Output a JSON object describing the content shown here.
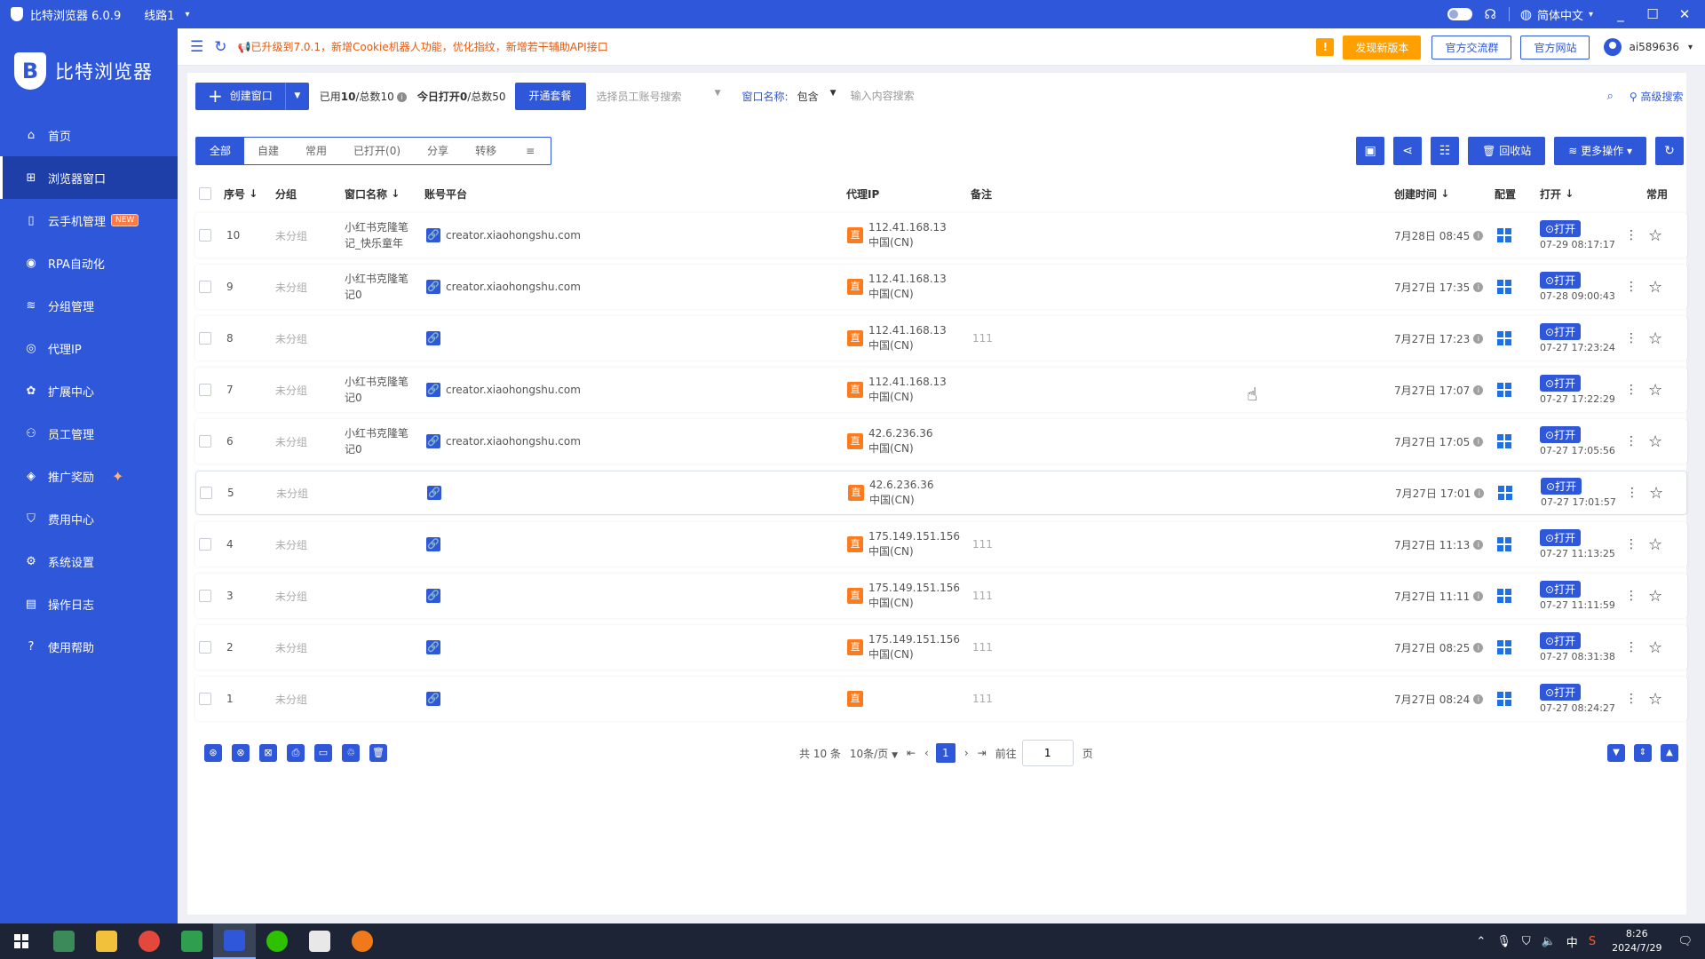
{
  "app": {
    "title": "比特浏览器 6.0.9",
    "line": "线路1",
    "language": "简体中文"
  },
  "sidebar": {
    "brand": "比特浏览器",
    "items": [
      {
        "label": "首页",
        "icon": "home-icon"
      },
      {
        "label": "浏览器窗口",
        "icon": "grid-icon"
      },
      {
        "label": "云手机管理",
        "icon": "phone-icon",
        "badge": "NEW"
      },
      {
        "label": "RPA自动化",
        "icon": "robot-icon"
      },
      {
        "label": "分组管理",
        "icon": "layers-icon"
      },
      {
        "label": "代理IP",
        "icon": "location-icon"
      },
      {
        "label": "扩展中心",
        "icon": "extension-icon"
      },
      {
        "label": "员工管理",
        "icon": "users-icon"
      },
      {
        "label": "推广奖励",
        "icon": "gift-icon"
      },
      {
        "label": "费用中心",
        "icon": "shield-icon"
      },
      {
        "label": "系统设置",
        "icon": "settings-icon"
      },
      {
        "label": "操作日志",
        "icon": "log-icon"
      },
      {
        "label": "使用帮助",
        "icon": "help-icon"
      }
    ]
  },
  "topbar": {
    "notice": "已升级到7.0.1，新增Cookie机器人功能，优化指纹，新增若干辅助API接口",
    "new_version": "发现新版本",
    "community": "官方交流群",
    "website": "官方网站",
    "user": "ai589636"
  },
  "toolbar": {
    "create": "创建窗口",
    "used_label": "已用",
    "used_value": "10",
    "used_total": "/总数10",
    "today_label": "今日打开",
    "today_value": "0",
    "today_total": "/总数50",
    "package": "开通套餐",
    "staff_placeholder": "选择员工账号搜索",
    "window_name_label": "窗口名称:",
    "match_mode": "包含",
    "search_placeholder": "输入内容搜索",
    "advanced": "高级搜索"
  },
  "tabs": [
    "全部",
    "自建",
    "常用",
    "已打开(0)",
    "分享",
    "转移"
  ],
  "tools": {
    "recycle": "回收站",
    "more": "更多操作"
  },
  "table": {
    "headers": {
      "seq": "序号",
      "group": "分组",
      "name": "窗口名称",
      "platform": "账号平台",
      "proxy": "代理IP",
      "remark": "备注",
      "created": "创建时间",
      "config": "配置",
      "open": "打开",
      "fav": "常用"
    },
    "open_label": "打开",
    "rows": [
      {
        "seq": "10",
        "group": "未分组",
        "name1": "小红书克隆笔",
        "name2": "记_快乐童年",
        "platform": "creator.xiaohongshu.com",
        "ip": "112.41.168.13",
        "region": "中国(CN)",
        "remark": "",
        "created": "7月28日 08:45",
        "opened": "07-29 08:17:17"
      },
      {
        "seq": "9",
        "group": "未分组",
        "name1": "小红书克隆笔",
        "name2": "记0",
        "platform": "creator.xiaohongshu.com",
        "ip": "112.41.168.13",
        "region": "中国(CN)",
        "remark": "",
        "created": "7月27日 17:35",
        "opened": "07-28 09:00:43"
      },
      {
        "seq": "8",
        "group": "未分组",
        "name1": "",
        "name2": "",
        "platform": "",
        "ip": "112.41.168.13",
        "region": "中国(CN)",
        "remark": "111",
        "created": "7月27日 17:23",
        "opened": "07-27 17:23:24"
      },
      {
        "seq": "7",
        "group": "未分组",
        "name1": "小红书克隆笔",
        "name2": "记0",
        "platform": "creator.xiaohongshu.com",
        "ip": "112.41.168.13",
        "region": "中国(CN)",
        "remark": "",
        "created": "7月27日 17:07",
        "opened": "07-27 17:22:29"
      },
      {
        "seq": "6",
        "group": "未分组",
        "name1": "小红书克隆笔",
        "name2": "记0",
        "platform": "creator.xiaohongshu.com",
        "ip": "42.6.236.36",
        "region": "中国(CN)",
        "remark": "",
        "created": "7月27日 17:05",
        "opened": "07-27 17:05:56"
      },
      {
        "seq": "5",
        "group": "未分组",
        "name1": "",
        "name2": "",
        "platform": "",
        "ip": "42.6.236.36",
        "region": "中国(CN)",
        "remark": "",
        "created": "7月27日 17:01",
        "opened": "07-27 17:01:57"
      },
      {
        "seq": "4",
        "group": "未分组",
        "name1": "",
        "name2": "",
        "platform": "",
        "ip": "175.149.151.156",
        "region": "中国(CN)",
        "remark": "111",
        "created": "7月27日 11:13",
        "opened": "07-27 11:13:25"
      },
      {
        "seq": "3",
        "group": "未分组",
        "name1": "",
        "name2": "",
        "platform": "",
        "ip": "175.149.151.156",
        "region": "中国(CN)",
        "remark": "111",
        "created": "7月27日 11:11",
        "opened": "07-27 11:11:59"
      },
      {
        "seq": "2",
        "group": "未分组",
        "name1": "",
        "name2": "",
        "platform": "",
        "ip": "175.149.151.156",
        "region": "中国(CN)",
        "remark": "111",
        "created": "7月27日 08:25",
        "opened": "07-27 08:31:38"
      },
      {
        "seq": "1",
        "group": "未分组",
        "name1": "",
        "name2": "",
        "platform": "",
        "ip": "",
        "region": "",
        "remark": "111",
        "created": "7月27日 08:24",
        "opened": "07-27 08:24:27"
      }
    ]
  },
  "pagination": {
    "total": "共 10 条",
    "page_size": "10条/页",
    "current": "1",
    "goto_label": "前往",
    "goto_value": "1",
    "page_suffix": "页"
  },
  "taskbar": {
    "time": "8:26",
    "date": "2024/7/29",
    "ime": "中"
  }
}
